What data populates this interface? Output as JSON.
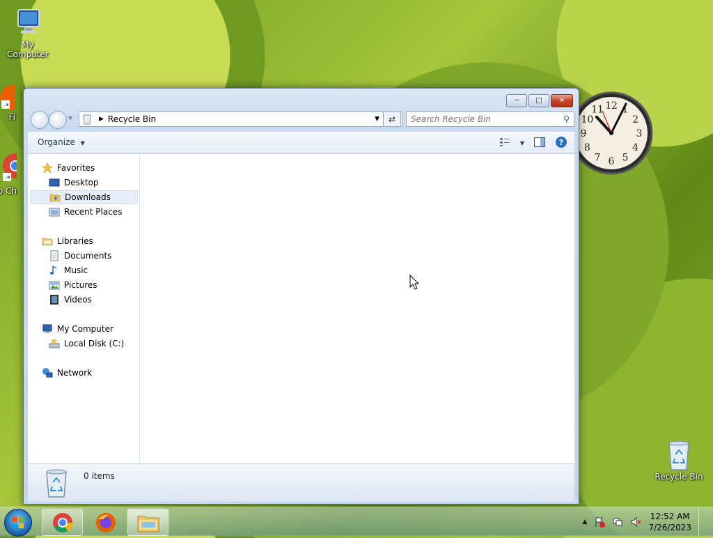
{
  "desktop": {
    "icons": [
      {
        "label": "My Computer"
      },
      {
        "label": "Fi"
      },
      {
        "label": "Go Ch"
      },
      {
        "label": "Recycle Bin"
      }
    ]
  },
  "window": {
    "address": "Recycle Bin",
    "search_placeholder": "Search Recycle Bin",
    "toolbar": {
      "organize": "Organize"
    },
    "nav": {
      "favorites": "Favorites",
      "desktop": "Desktop",
      "downloads": "Downloads",
      "recent_places": "Recent Places",
      "libraries": "Libraries",
      "documents": "Documents",
      "music": "Music",
      "pictures": "Pictures",
      "videos": "Videos",
      "my_computer": "My Computer",
      "local_disk": "Local Disk (C:)",
      "network": "Network"
    },
    "details": {
      "count": "0 items"
    }
  },
  "clock_gadget": {
    "numbers": [
      "12",
      "1",
      "2",
      "3",
      "4",
      "5",
      "6",
      "7",
      "8",
      "9",
      "10",
      "11"
    ]
  },
  "taskbar": {
    "time": "12:52 AM",
    "date": "7/26/2023"
  },
  "colors": {
    "accent": "#1e395b",
    "close": "#c5462b"
  }
}
